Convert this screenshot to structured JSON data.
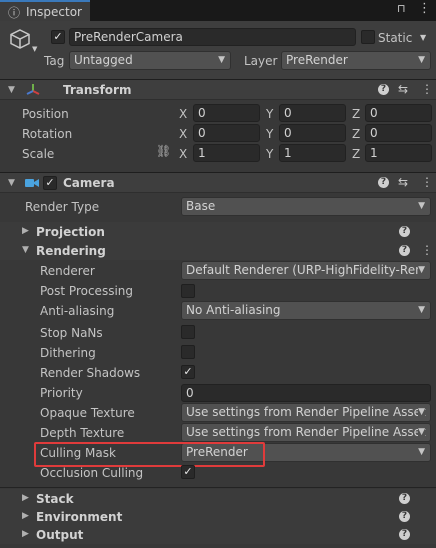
{
  "window": {
    "tab_title": "Inspector"
  },
  "header": {
    "active_checked": true,
    "object_name": "PreRenderCamera",
    "static_label": "Static",
    "tag_label": "Tag",
    "tag_value": "Untagged",
    "layer_label": "Layer",
    "layer_value": "PreRender"
  },
  "transform": {
    "title": "Transform",
    "rows": [
      {
        "label": "Position",
        "x": "0",
        "y": "0",
        "z": "0"
      },
      {
        "label": "Rotation",
        "x": "0",
        "y": "0",
        "z": "0"
      },
      {
        "label": "Scale",
        "x": "1",
        "y": "1",
        "z": "1"
      }
    ],
    "axis": {
      "x": "X",
      "y": "Y",
      "z": "Z"
    }
  },
  "camera": {
    "title": "Camera",
    "enabled": true,
    "render_type_label": "Render Type",
    "render_type_value": "Base",
    "sections": {
      "projection": "Projection",
      "rendering": "Rendering",
      "stack": "Stack",
      "environment": "Environment",
      "output": "Output"
    },
    "rendering": {
      "renderer_label": "Renderer",
      "renderer_value": "Default Renderer (URP-HighFidelity-Ren",
      "post_processing_label": "Post Processing",
      "post_processing": false,
      "anti_aliasing_label": "Anti-aliasing",
      "anti_aliasing_value": "No Anti-aliasing",
      "stop_nans_label": "Stop NaNs",
      "stop_nans": false,
      "dithering_label": "Dithering",
      "dithering": false,
      "render_shadows_label": "Render Shadows",
      "render_shadows": true,
      "priority_label": "Priority",
      "priority_value": "0",
      "opaque_texture_label": "Opaque Texture",
      "opaque_texture_value": "Use settings from Render Pipeline Asset",
      "depth_texture_label": "Depth Texture",
      "depth_texture_value": "Use settings from Render Pipeline Asset",
      "culling_mask_label": "Culling Mask",
      "culling_mask_value": "PreRender",
      "occlusion_culling_label": "Occlusion Culling",
      "occlusion_culling": true
    }
  },
  "colors": {
    "highlight": "#e03b3b",
    "tab_accent": "#3a79bb",
    "background": "#383838"
  },
  "icons": {
    "help": "?",
    "presets": "⇆",
    "more": "⋮",
    "lock": "🔒",
    "fold_open": "▼",
    "fold_closed": "▶",
    "check": "✓",
    "dropdown": "▼"
  }
}
